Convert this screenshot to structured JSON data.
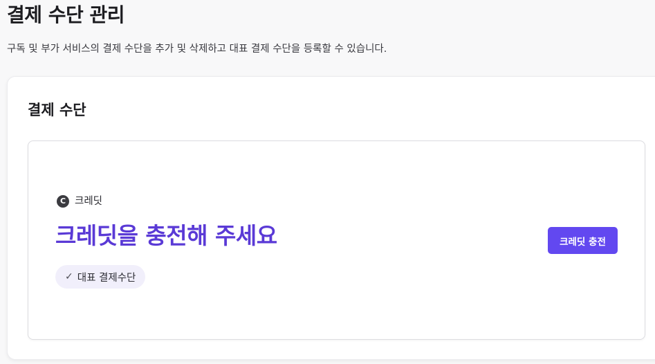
{
  "header": {
    "title": "결제 수단 관리",
    "description": "구독 및 부가 서비스의 결제 수단을 추가 및 삭제하고 대표 결제 수단을 등록할 수 있습니다."
  },
  "section": {
    "title": "결제 수단"
  },
  "payment_method": {
    "icon": "credit-coin-icon",
    "icon_letter": "C",
    "type_label": "크레딧",
    "headline": "크레딧을 충전해 주세요",
    "badge_check": "✓",
    "badge_label": "대표 결제수단",
    "action_label": "크레딧 충전"
  },
  "colors": {
    "accent": "#6248f0",
    "headline": "#5a3ad6",
    "badge_bg": "#f1effb"
  }
}
